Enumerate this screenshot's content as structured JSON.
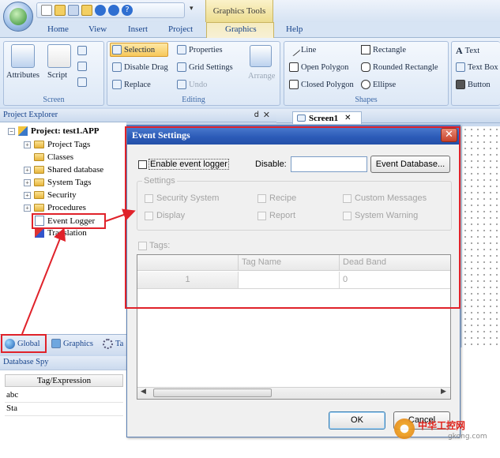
{
  "quick_access_overflow": "▾",
  "contextual_tab": "Graphics Tools",
  "tabs": [
    "Home",
    "View",
    "Insert",
    "Project",
    "Graphics",
    "Help"
  ],
  "ribbon": {
    "screen": {
      "label": "Screen",
      "attributes": "Attributes",
      "script": "Script"
    },
    "editing": {
      "label": "Editing",
      "selection": "Selection",
      "properties": "Properties",
      "disable_drag": "Disable Drag",
      "grid_settings": "Grid Settings",
      "replace": "Replace",
      "undo": "Undo",
      "arrange": "Arrange"
    },
    "shapes": {
      "label": "Shapes",
      "line": "Line",
      "rectangle": "Rectangle",
      "open_polygon": "Open Polygon",
      "rounded_rectangle": "Rounded Rectangle",
      "closed_polygon": "Closed Polygon",
      "ellipse": "Ellipse"
    },
    "right": {
      "text": "Text",
      "text_box": "Text Box",
      "button": "Button"
    }
  },
  "project_explorer": {
    "title": "Project Explorer",
    "pin": "ⅾ",
    "close": "✕",
    "root": "Project: test1.APP",
    "items": [
      "Project Tags",
      "Classes",
      "Shared database",
      "System Tags",
      "Security",
      "Procedures",
      "Event Logger",
      "Translation"
    ]
  },
  "bottom_tabs": [
    "Global",
    "Graphics",
    "Ta"
  ],
  "database_spy": {
    "title": "Database Spy",
    "column": "Tag/Expression",
    "rows": [
      "abc",
      "Sta"
    ]
  },
  "screen_tab": {
    "label": "Screen1",
    "close": "✕"
  },
  "dialog": {
    "title": "Event Settings",
    "close": "✕",
    "enable_label": "Enable event logger",
    "disable_label": "Disable:",
    "disable_value": "",
    "event_db_button": "Event Database...",
    "settings_title": "Settings",
    "settings": [
      "Security System",
      "Recipe",
      "Custom Messages",
      "Display",
      "Report",
      "System Warning"
    ],
    "tags_label": "Tags:",
    "grid_headers": [
      "",
      "Tag Name",
      "Dead Band"
    ],
    "grid_row": [
      "1",
      "",
      "0"
    ],
    "ok": "OK",
    "cancel": "Cancel"
  },
  "watermark": {
    "line1": "中华工控网",
    "line2": "gkong.com"
  },
  "colors": {
    "highlight_red": "#e0222a",
    "title_blue": "#2c5bb8",
    "ribbon_text": "#15428b"
  }
}
